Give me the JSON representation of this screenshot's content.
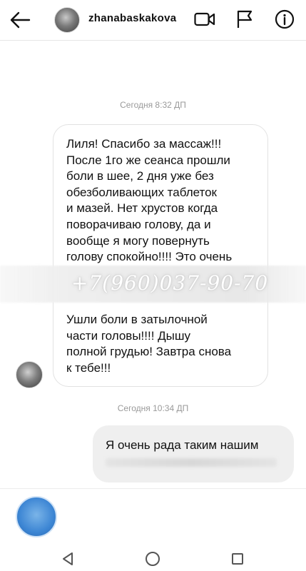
{
  "header": {
    "username": "zhanabaskakova",
    "icons": [
      "back-arrow-icon",
      "video-camera-icon",
      "flag-icon",
      "info-icon"
    ]
  },
  "conversation": {
    "timestamp_1": "Сегодня 8:32 ДП",
    "incoming_message": {
      "lines": [
        "Лиля! Спасибо за массаж!!!",
        "После 1го же сеанса прошли",
        "боли в шее, 2 дня уже без",
        "обезболивающих таблеток",
        "и мазей. Нет хрустов когда",
        "поворачиваю голову, да и",
        "вообще я могу повернуть",
        "голову спокойно!!!! Это очень"
      ],
      "redacted_overlay": "+7(960)037-90-70",
      "lines_after": [
        "Ушли боли в затылочной",
        "части головы!!!! Дышу",
        "полной грудью! Завтра снова",
        "к тебе!!!"
      ]
    },
    "timestamp_2": "Сегодня 10:34 ДП",
    "outgoing_message": {
      "text": "Я очень рада таким нашим"
    }
  },
  "composer": {
    "placeholder": ""
  },
  "colors": {
    "incoming_border": "#e2e2e2",
    "outgoing_bg": "#efefef",
    "timestamp": "#9a9a9a"
  }
}
